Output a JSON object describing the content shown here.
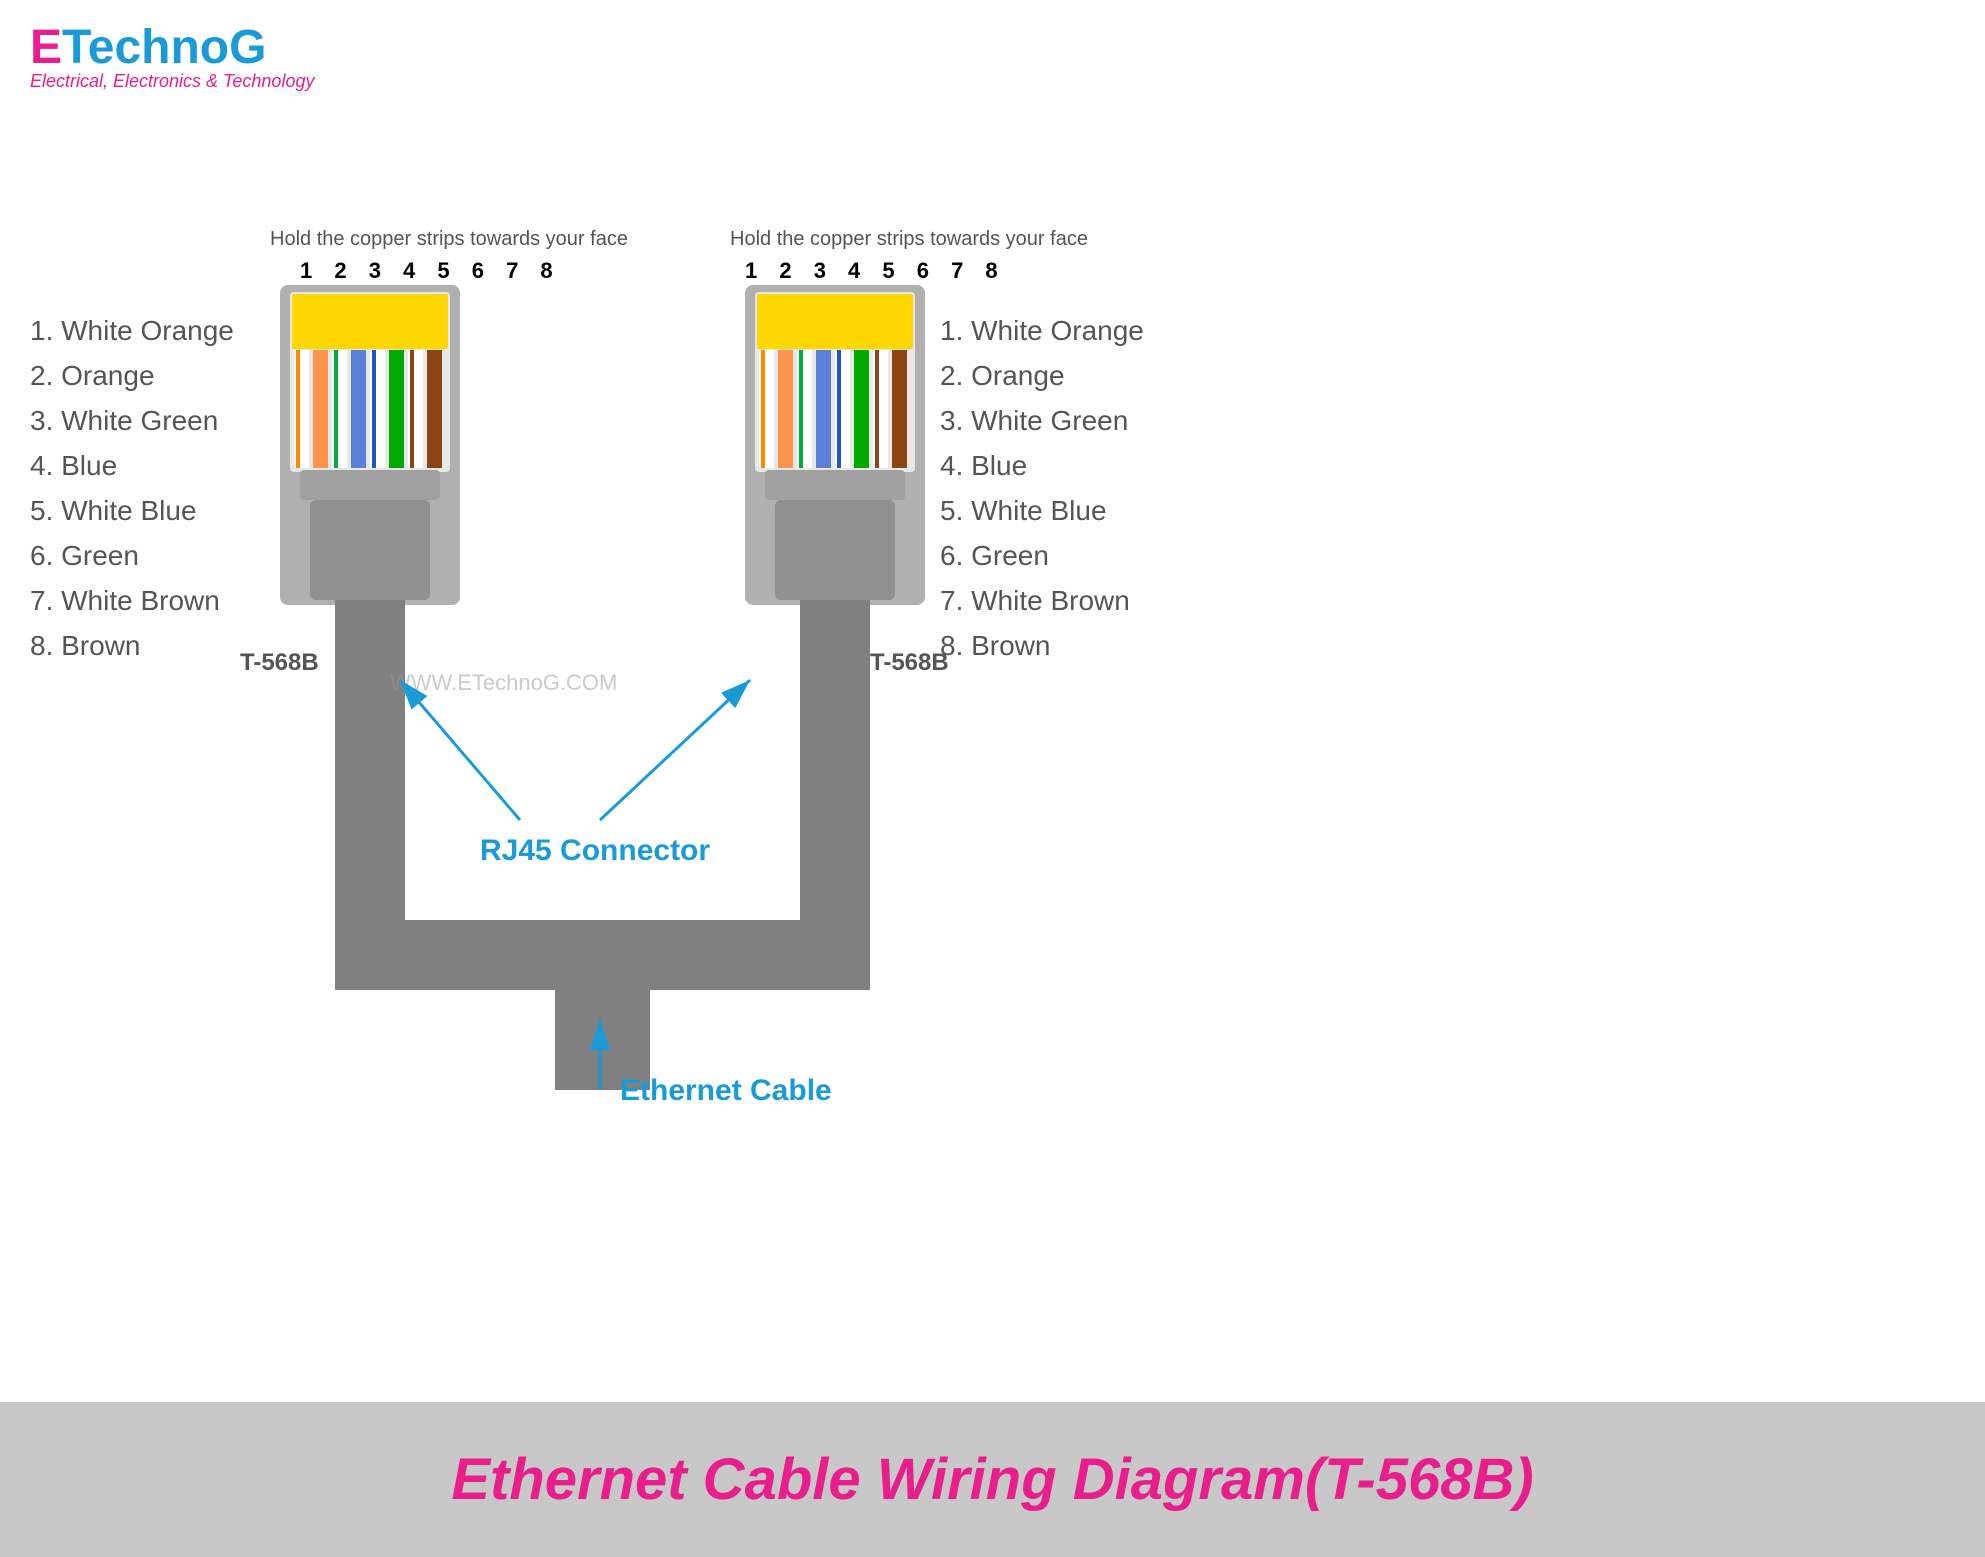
{
  "logo": {
    "e": "E",
    "technog": "TechnoG",
    "tagline": "Electrical, Electronics & Technology"
  },
  "left_connector": {
    "instruction": "Hold the copper strips towards your face",
    "pin_numbers": "1 2 3 4 5 6 7 8",
    "label": "T-568B",
    "wires": [
      "1.  White Orange",
      "2.  Orange",
      "3.  White Green",
      "4.  Blue",
      "5.  White Blue",
      "6.  Green",
      "7.  White Brown",
      "8.  Brown"
    ]
  },
  "right_connector": {
    "instruction": "Hold the copper strips towards your face",
    "pin_numbers": "1 2 3 4 5 6 7 8",
    "label": "T-568B",
    "wires": [
      "1.  White Orange",
      "2.  Orange",
      "3.  White Green",
      "4.  Blue",
      "5.  White Blue",
      "6.  Green",
      "7.  White Brown",
      "8.  Brown"
    ]
  },
  "labels": {
    "rj45_connector": "RJ45 Connector",
    "ethernet_cable": "Ethernet Cable",
    "watermark": "WWW.ETechnoG.COM"
  },
  "bottom": {
    "title": "Ethernet Cable Wiring Diagram(T-568B)"
  },
  "colors": {
    "accent_blue": "#1a9bd7",
    "accent_pink": "#e91e8c",
    "gray": "#808080",
    "light_gray": "#c8c8c8",
    "white_orange": "#ff8c00",
    "orange": "#ff6600",
    "white_green": "#00aa44",
    "blue": "#2255cc",
    "white_blue": "#4477ee",
    "green": "#00aa00",
    "brown": "#8B4513",
    "yellow": "#FFD700"
  }
}
